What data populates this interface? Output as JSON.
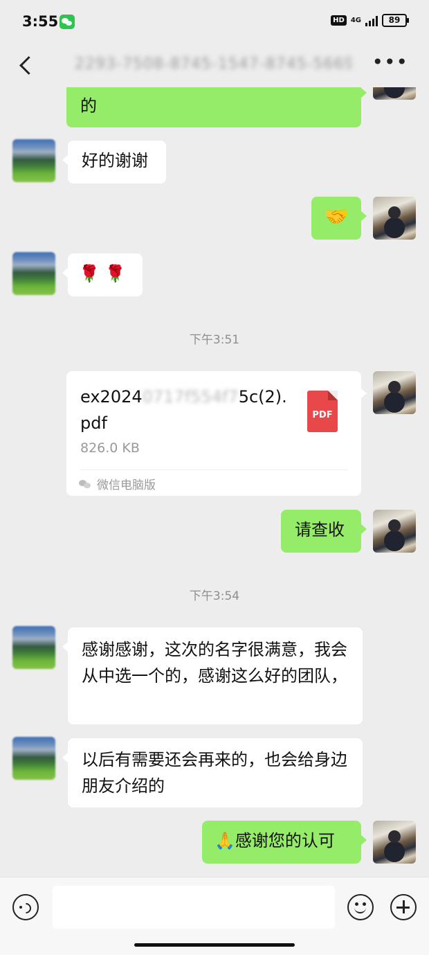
{
  "status_bar": {
    "time": "3:55",
    "hd": "HD",
    "network": "4G",
    "battery": "89"
  },
  "header": {
    "title": "2293-7508-8745-1547-8745-5669"
  },
  "messages": {
    "m1_text": "的",
    "m2_text": "好的谢谢",
    "m3_text": "🤝",
    "m4_text": "🌹 🌹",
    "ts1": "下午3:51",
    "file": {
      "name_prefix": "ex2024",
      "name_hidden": "0717f554f7",
      "name_suffix": "5c(2).pdf",
      "size": "826.0 KB",
      "icon_label": "PDF",
      "source": "微信电脑版"
    },
    "m6_text": "请查收",
    "ts2": "下午3:54",
    "m7_text": "感谢感谢，这次的名字很满意，我会从中选一个的，感谢这么好的团队，",
    "m8_text": "以后有需要还会再来的，也会给身边朋友介绍的",
    "m9_text": "🙏感谢您的认可"
  },
  "input": {
    "placeholder": ""
  }
}
